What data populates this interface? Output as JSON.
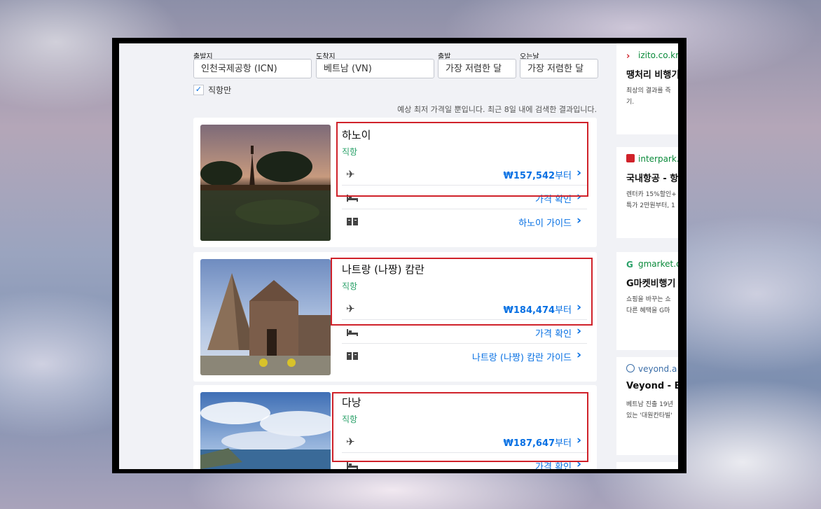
{
  "search": {
    "origin_label": "출발지",
    "origin_value": "인천국제공항 (ICN)",
    "destination_label": "도착지",
    "destination_value": "베트남 (VN)",
    "depart_label": "출발",
    "depart_value": "가장 저렴한 달",
    "return_label": "오는날",
    "return_value": "가장 저렴한 달",
    "direct_only_label": "직항만",
    "direct_only_checked": true
  },
  "notice": "예상 최저 가격일 뿐입니다. 최근 8일 내에 검색한 결과입니다.",
  "results": [
    {
      "city": "하노이",
      "direct": "직항",
      "flight_price": "₩157,542",
      "price_suffix": "부터",
      "hotel_label": "가격 확인",
      "guide_label": "하노이 가이드"
    },
    {
      "city": "나트랑 (나짱) 캄란",
      "direct": "직항",
      "flight_price": "₩184,474",
      "price_suffix": "부터",
      "hotel_label": "가격 확인",
      "guide_label": "나트랑 (나짱) 캄란 가이드"
    },
    {
      "city": "다낭",
      "direct": "직항",
      "flight_price": "₩187,647",
      "price_suffix": "부터",
      "hotel_label": "가격 확인"
    }
  ],
  "ads": [
    {
      "source": "izito.co.kr",
      "title": "땡처리 비행기",
      "desc1": "최상의 결과를 즉",
      "desc2": "기."
    },
    {
      "source": "interpark.",
      "title": "국내항공 - 항",
      "desc1": "렌터카 15%할인+",
      "desc2": "특가 2만원부터, 1"
    },
    {
      "source": "gmarket.c",
      "title": "G마켓비행기",
      "desc1": "쇼핑을 바꾸는 쇼",
      "desc2": "다른 혜택을 G마"
    },
    {
      "source": "veyond.a",
      "title": "Veyond - Be",
      "desc1": "베트남 진출 19년",
      "desc2": "있는 '대원칸타빌'"
    }
  ],
  "colors": {
    "accent": "#0770e3",
    "direct": "#2aa169",
    "highlight": "#d0222a"
  }
}
